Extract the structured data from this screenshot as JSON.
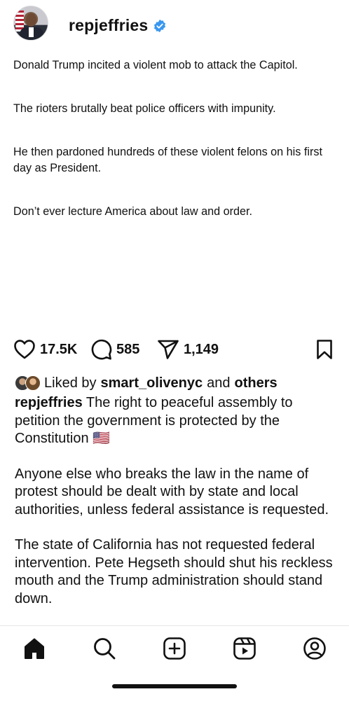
{
  "header": {
    "username": "repjeffries",
    "verified_icon": "verified-badge-icon",
    "verified_color": "#3897f0"
  },
  "tweet": {
    "paragraphs": [
      "Donald Trump incited a violent mob to attack the Capitol.",
      "The rioters brutally beat police officers with impunity.",
      "He then pardoned hundreds of these violent felons on his first day as President.",
      "Don’t ever lecture America about law and order."
    ]
  },
  "actions": {
    "likes": "17.5K",
    "comments": "585",
    "shares": "1,149",
    "icons": [
      "heart-icon",
      "comment-icon",
      "share-icon",
      "bookmark-icon"
    ]
  },
  "liked_by": {
    "prefix": "Liked by",
    "user": "smart_olivenyc",
    "conjunction": "and",
    "others": "others"
  },
  "caption": {
    "username": "repjeffries",
    "paragraph1": "The right to peaceful assembly to petition the government is protected by the Constitution 🇺🇸",
    "paragraph2": "Anyone else who breaks the law in the name of protest should be dealt with by state and local authorities, unless federal assistance is requested.",
    "paragraph3": "The state of California has not requested federal intervention. Pete Hegseth should shut his reckless mouth and the Trump administration should stand down."
  },
  "bottom_nav": {
    "items": [
      "home-icon",
      "search-icon",
      "create-icon",
      "reels-icon",
      "profile-icon"
    ]
  }
}
